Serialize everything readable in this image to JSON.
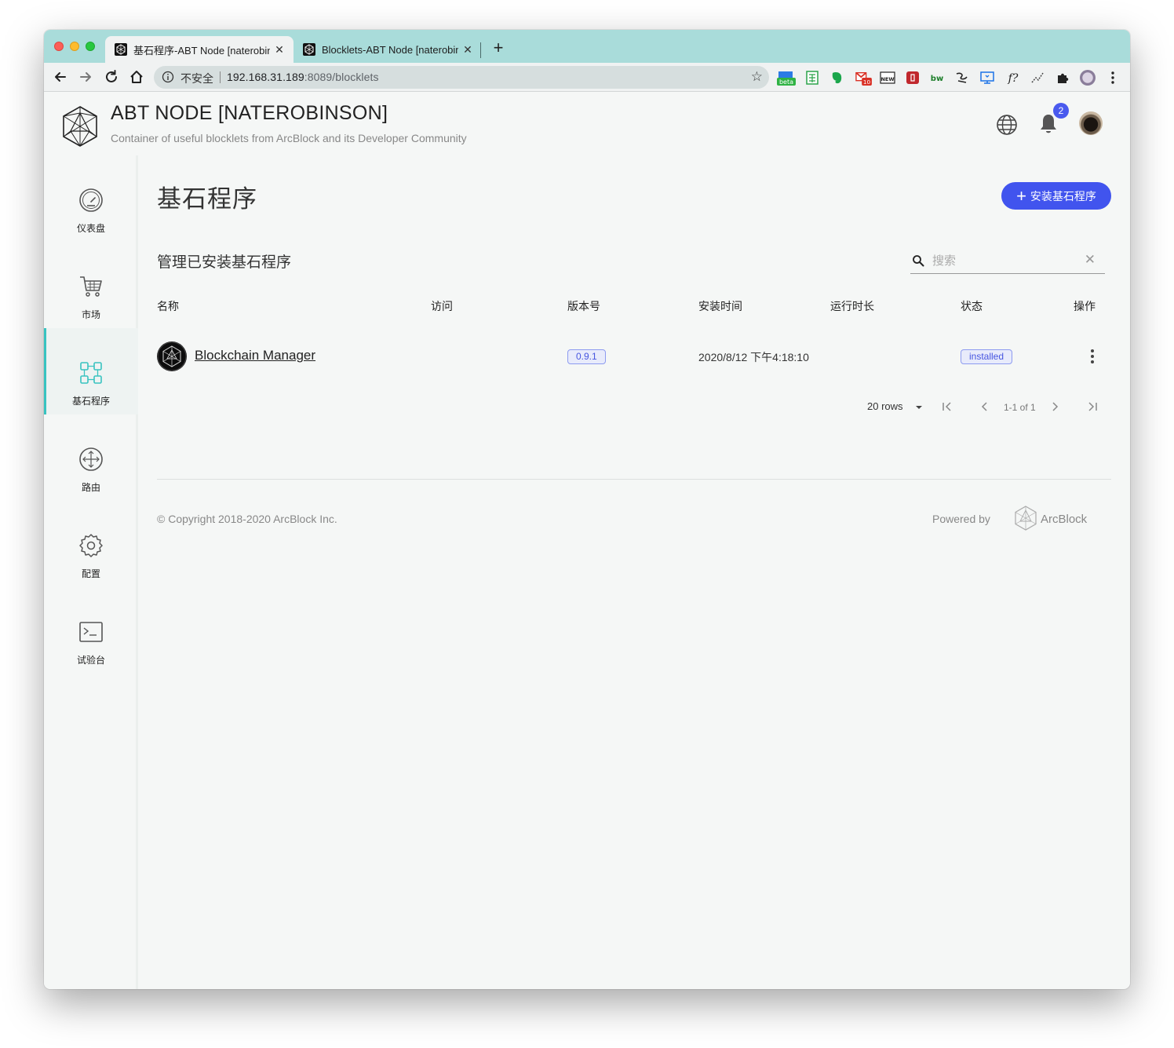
{
  "browser": {
    "tabs": [
      {
        "title": "基石程序-ABT Node [naterobinson]",
        "active": true
      },
      {
        "title": "Blocklets-ABT Node [naterobinson]",
        "active": false
      }
    ],
    "new_tab_label": "+",
    "close_label": "✕",
    "security_label": "不安全",
    "url_host": "192.168.31.189",
    "url_rest": ":8089/blocklets",
    "extensions": [
      "beta-extension-icon",
      "sheets-icon",
      "evernote-icon",
      "gmail-icon",
      "news-icon",
      "red-bookmark-icon",
      "bw-icon",
      "scribble-icon",
      "screen-icon",
      "formula-icon",
      "path-icon",
      "puzzle-icon",
      "profile-icon",
      "menu-icon"
    ],
    "ext_badges": {
      "beta": "beta",
      "gmail": "10",
      "news": "NEW",
      "bw": "bw",
      "formula": "f?"
    }
  },
  "header": {
    "title": "ABT NODE [NATEROBINSON]",
    "subtitle": "Container of useful blocklets from ArcBlock and its Developer Community",
    "notification_count": "2"
  },
  "sidebar": {
    "items": [
      {
        "label": "仪表盘",
        "icon": "dashboard-icon",
        "active": false
      },
      {
        "label": "市场",
        "icon": "cart-icon",
        "active": false
      },
      {
        "label": "基石程序",
        "icon": "blocklets-icon",
        "active": true
      },
      {
        "label": "路由",
        "icon": "router-icon",
        "active": false
      },
      {
        "label": "配置",
        "icon": "settings-icon",
        "active": false
      },
      {
        "label": "试验台",
        "icon": "terminal-icon",
        "active": false
      }
    ]
  },
  "main": {
    "page_title": "基石程序",
    "install_button": "安装基石程序",
    "section_title": "管理已安装基石程序",
    "search_placeholder": "搜索",
    "columns": [
      "名称",
      "访问",
      "版本号",
      "安装时间",
      "运行时长",
      "状态",
      "操作"
    ],
    "rows": [
      {
        "name": "Blockchain Manager",
        "access": "",
        "version": "0.9.1",
        "installed_at": "2020/8/12 下午4:18:10",
        "uptime": "",
        "status": "installed"
      }
    ],
    "pagination": {
      "rows_per_page": "20 rows",
      "range": "1-1 of 1"
    }
  },
  "footer": {
    "copyright": "© Copyright 2018-2020  ArcBlock Inc.",
    "powered_by": "Powered by",
    "brand": "ArcBlock"
  },
  "colors": {
    "tab_strip": "#a9dcda",
    "accent": "#4154ee",
    "active_sidebar": "#38c3c0",
    "background": "#f5f7f6"
  }
}
